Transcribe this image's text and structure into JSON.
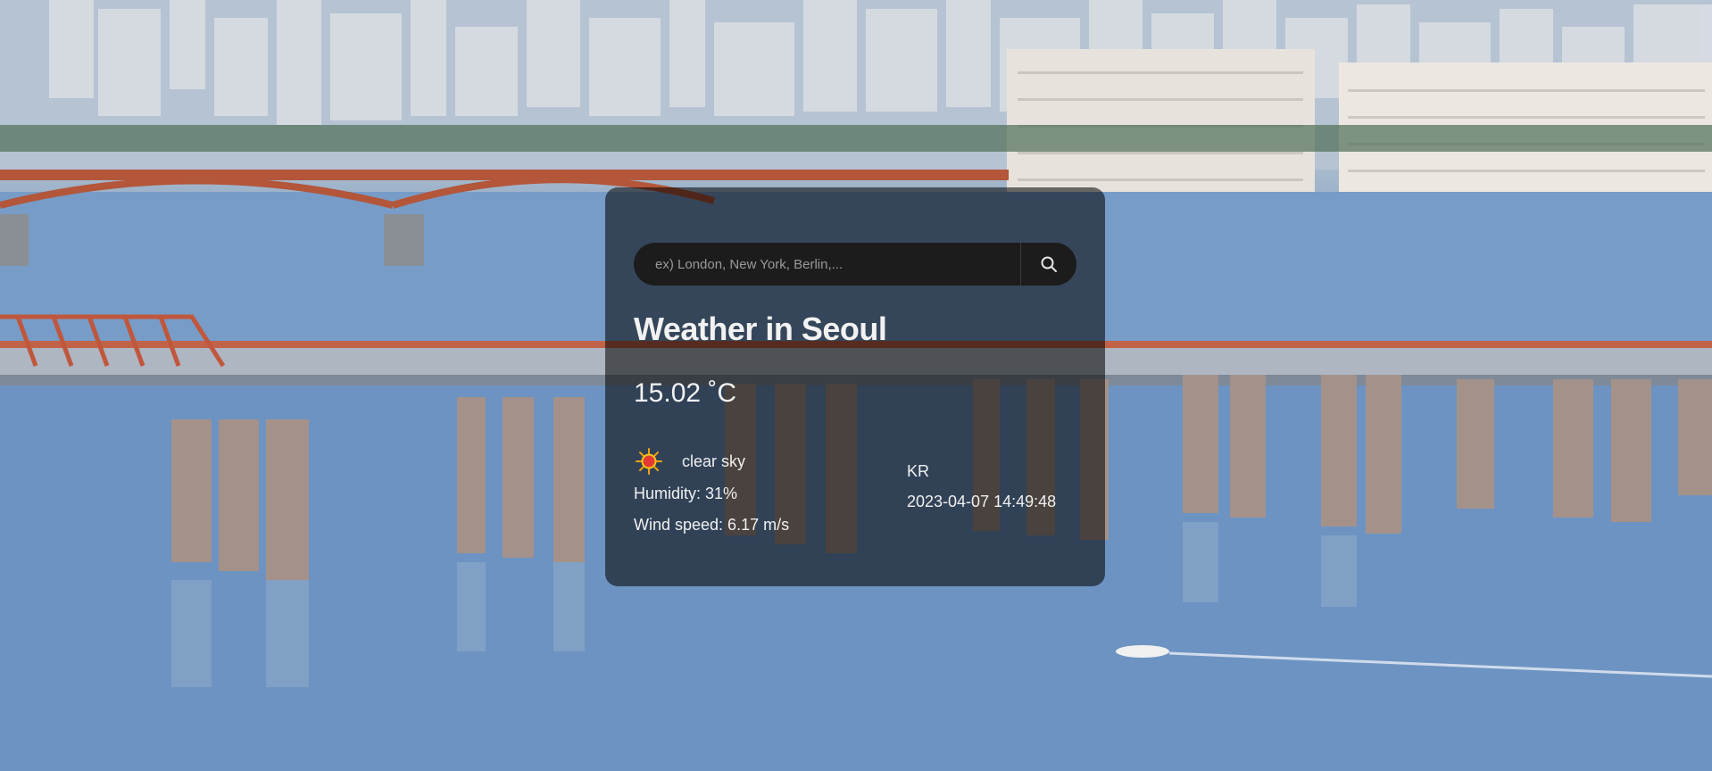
{
  "search": {
    "placeholder": "ex) London, New York, Berlin,...",
    "value": "",
    "button_icon": "search-icon"
  },
  "weather": {
    "title": "Weather in Seoul",
    "temperature": "15.02 ˚C",
    "description": "clear sky",
    "icon": "sun-icon",
    "humidity": "Humidity: 31%",
    "wind": "Wind speed: 6.17 m/s",
    "country": "KR",
    "datetime": "2023-04-07 14:49:48"
  },
  "colors": {
    "card_bg": "#000000",
    "text": "#ffffff",
    "sun": "#e53935"
  }
}
